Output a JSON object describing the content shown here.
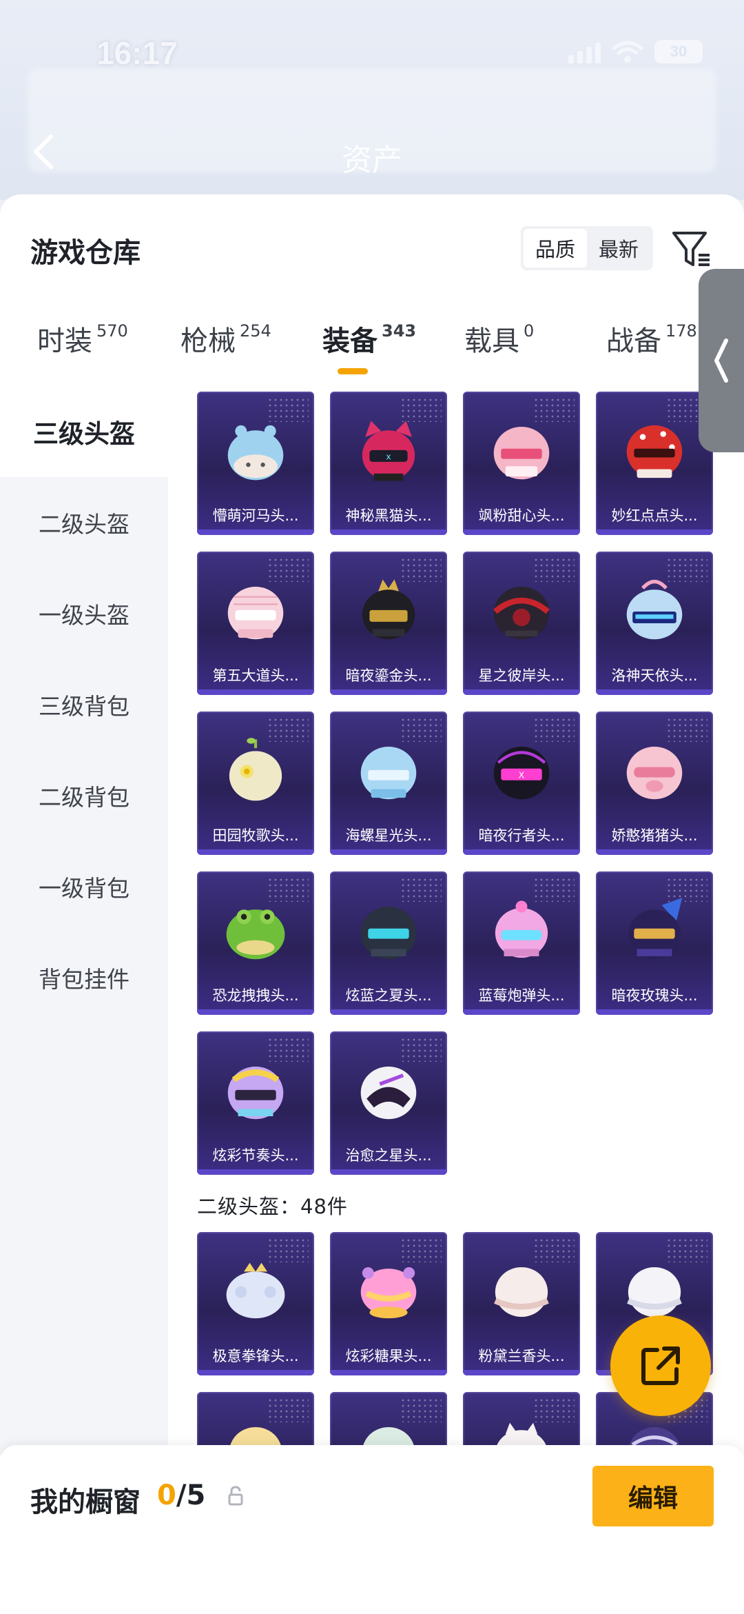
{
  "status_bar": {
    "time": "16:17",
    "battery": "30"
  },
  "header": {
    "title": "资产"
  },
  "panel": {
    "title": "游戏仓库",
    "sort_options": [
      "品质",
      "最新"
    ],
    "active_sort": "品质"
  },
  "tabs": [
    {
      "label": "时装",
      "count": "570"
    },
    {
      "label": "枪械",
      "count": "254"
    },
    {
      "label": "装备",
      "count": "343"
    },
    {
      "label": "载具",
      "count": "0"
    },
    {
      "label": "战备",
      "count": "178"
    }
  ],
  "active_tab": "装备",
  "sidebar": {
    "items": [
      "三级头盔",
      "二级头盔",
      "一级头盔",
      "三级背包",
      "二级背包",
      "一级背包",
      "背包挂件"
    ],
    "active": "三级头盔"
  },
  "sections": [
    {
      "header": "",
      "items": [
        {
          "label": "懵萌河马头...",
          "icon": "hippo-helmet-icon"
        },
        {
          "label": "神秘黑猫头...",
          "icon": "black-cat-helmet-icon"
        },
        {
          "label": "飒粉甜心头...",
          "icon": "pink-sweetheart-helmet-icon"
        },
        {
          "label": "妙红点点头...",
          "icon": "red-dots-helmet-icon"
        },
        {
          "label": "第五大道头...",
          "icon": "fifth-avenue-helmet-icon"
        },
        {
          "label": "暗夜鎏金头...",
          "icon": "dark-gold-helmet-icon"
        },
        {
          "label": "星之彼岸头...",
          "icon": "star-shore-helmet-icon"
        },
        {
          "label": "洛神天依头...",
          "icon": "luo-tianyi-helmet-icon"
        },
        {
          "label": "田园牧歌头...",
          "icon": "pastoral-helmet-icon"
        },
        {
          "label": "海螺星光头...",
          "icon": "conch-starlight-helmet-icon"
        },
        {
          "label": "暗夜行者头...",
          "icon": "night-walker-helmet-icon"
        },
        {
          "label": "娇憨猪猪头...",
          "icon": "piggy-helmet-icon"
        },
        {
          "label": "恐龙拽拽头...",
          "icon": "dinosaur-helmet-icon"
        },
        {
          "label": "炫蓝之夏头...",
          "icon": "blue-summer-helmet-icon"
        },
        {
          "label": "蓝莓炮弹头...",
          "icon": "blueberry-bomb-helmet-icon"
        },
        {
          "label": "暗夜玫瑰头...",
          "icon": "night-rose-helmet-icon"
        },
        {
          "label": "炫彩节奏头...",
          "icon": "colorful-rhythm-helmet-icon"
        },
        {
          "label": "治愈之星头...",
          "icon": "healing-star-helmet-icon"
        }
      ]
    },
    {
      "header": "二级头盔：48件",
      "items": [
        {
          "label": "极意拳锋头...",
          "icon": "fist-helmet-icon"
        },
        {
          "label": "炫彩糖果头...",
          "icon": "candy-helmet-icon"
        },
        {
          "label": "粉黛兰香头...",
          "icon": "orchid-helmet-icon"
        },
        {
          "label": "",
          "icon": "white-helmet-icon"
        },
        {
          "label": "",
          "icon": "yellow-helmet-icon"
        },
        {
          "label": "",
          "icon": "mint-helmet-icon"
        },
        {
          "label": "",
          "icon": "cat-ear-helmet-icon"
        },
        {
          "label": "",
          "icon": "purple-helmet-icon"
        }
      ]
    }
  ],
  "bottom_bar": {
    "label": "我的橱窗",
    "count_current": "0",
    "count_total": "/5",
    "edit_label": "编辑"
  },
  "colors": {
    "accent": "#f5a300",
    "card_top": "#3e3282",
    "card_bottom": "#2b2158",
    "edit_button": "#fbb117"
  }
}
